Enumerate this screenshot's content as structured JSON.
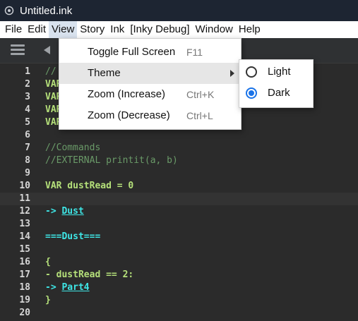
{
  "window": {
    "title": "Untitled.ink"
  },
  "menubar": {
    "items": [
      "File",
      "Edit",
      "View",
      "Story",
      "Ink",
      "[Inky Debug]",
      "Window",
      "Help"
    ],
    "active": "View"
  },
  "view_menu": {
    "items": [
      {
        "label": "Toggle Full Screen",
        "accel": "F11"
      },
      {
        "label": "Theme",
        "accel": "",
        "submenu": true
      },
      {
        "label": "Zoom (Increase)",
        "accel": "Ctrl+K"
      },
      {
        "label": "Zoom (Decrease)",
        "accel": "Ctrl+L"
      }
    ]
  },
  "theme_menu": {
    "items": [
      {
        "label": "Light",
        "checked": false
      },
      {
        "label": "Dark",
        "checked": true
      }
    ]
  },
  "editor": {
    "lines": [
      {
        "n": "1",
        "text": "//"
      },
      {
        "n": "2",
        "text": "VAR"
      },
      {
        "n": "3",
        "text": "VAR"
      },
      {
        "n": "4",
        "text": "VAR"
      },
      {
        "n": "5",
        "text": "VAR"
      },
      {
        "n": "6",
        "text": ""
      },
      {
        "n": "7",
        "text": "//Commands"
      },
      {
        "n": "8",
        "text": "//EXTERNAL printit(a, b)"
      },
      {
        "n": "9",
        "text": ""
      },
      {
        "n": "10",
        "text": "VAR dustRead = 0"
      },
      {
        "n": "11",
        "text": ""
      },
      {
        "n": "12",
        "pre": "-> ",
        "link": "Dust"
      },
      {
        "n": "13",
        "text": ""
      },
      {
        "n": "14",
        "text": "===Dust==="
      },
      {
        "n": "15",
        "text": ""
      },
      {
        "n": "16",
        "text": "{"
      },
      {
        "n": "17",
        "text": "- dustRead == 2:"
      },
      {
        "n": "18",
        "pre": "-> ",
        "link": "Part4"
      },
      {
        "n": "19",
        "text": "}"
      },
      {
        "n": "20",
        "text": ""
      }
    ],
    "current_line": "11"
  }
}
